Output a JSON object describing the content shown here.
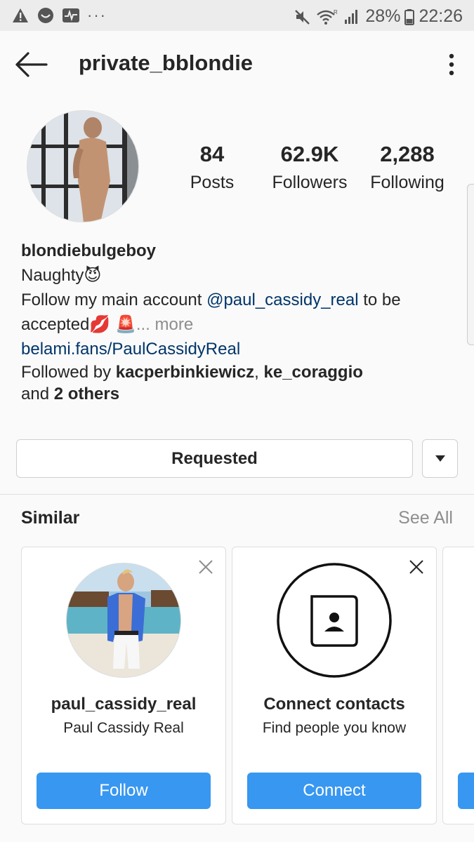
{
  "status_bar": {
    "battery": "28%",
    "time": "22:26",
    "dots": "···"
  },
  "header": {
    "username": "private_bblondie"
  },
  "stats": [
    {
      "value": "84",
      "label": "Posts"
    },
    {
      "value": "62.9K",
      "label": "Followers"
    },
    {
      "value": "2,288",
      "label": "Following"
    }
  ],
  "bio": {
    "name": "blondiebulgeboy",
    "line1": "Naughty😈",
    "line2_prefix": "Follow my main account ",
    "line2_mention": "@paul_cassidy_real",
    "line2_suffix": " to be",
    "line3": "accepted💋 🚨",
    "more": "... more",
    "website": "belami.fans/PaulCassidyReal",
    "followed_by_prefix": "Followed by ",
    "followed_user1": "kacperbinkiewicz",
    "followed_sep": ", ",
    "followed_user2": "ke_coraggio",
    "followed_and": "and ",
    "followed_others": "2 others"
  },
  "actions": {
    "requested": "Requested"
  },
  "similar": {
    "title": "Similar",
    "see_all": "See All",
    "cards": [
      {
        "name": "paul_cassidy_real",
        "subtitle": "Paul Cassidy Real",
        "button": "Follow"
      },
      {
        "name": "Connect contacts",
        "subtitle": "Find people you know",
        "button": "Connect"
      }
    ]
  },
  "colors": {
    "accent": "#3897f0",
    "link": "#003569",
    "muted": "#8e8e8e"
  }
}
